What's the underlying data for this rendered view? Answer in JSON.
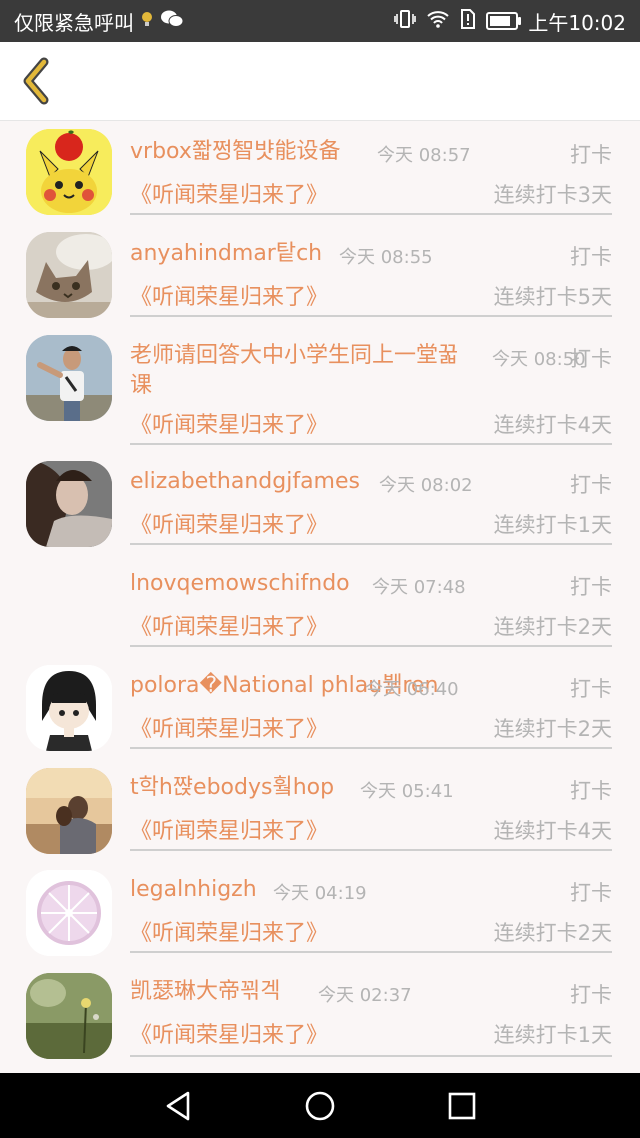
{
  "status_bar": {
    "left_text": "仅限紧急呼叫",
    "right_text": "上午10:02",
    "battery_level": 0.85,
    "icons": [
      "bulb-icon",
      "wechat-icon",
      "vibrate-icon",
      "wifi-icon",
      "sim-alert-icon",
      "battery-icon"
    ]
  },
  "header": {
    "back_icon": "chevron-left-icon",
    "accent_color": "#e2b83a"
  },
  "colors": {
    "name": "#e8905e",
    "muted": "#b4b4b4",
    "divider": "#cfcfcf"
  },
  "list": {
    "items": [
      {
        "name": "vrbox쫣쩡智뱟能设备",
        "time": "今天 08:57",
        "action": "打卡",
        "book": "《听闻荣星归来了》",
        "streak": "连续打卡3天",
        "avatar": "pikachu-avatar"
      },
      {
        "name": "anyahindmar탙ch",
        "time": "今天 08:55",
        "action": "打卡",
        "book": "《听闻荣星归来了》",
        "streak": "连续打卡5天",
        "avatar": "kitten-avatar"
      },
      {
        "name": "老师请回答大中小学生同上一堂꿃课",
        "time": "今天 08:50",
        "action": "打卡",
        "book": "《听闻荣星归来了》",
        "streak": "连续打卡4天",
        "avatar": "boy-avatar"
      },
      {
        "name": "elizabethandgjfames",
        "time": "今天 08:02",
        "action": "打卡",
        "book": "《听闻荣星归来了》",
        "streak": "连续打卡1天",
        "avatar": "woman-avatar"
      },
      {
        "name": "lnovqemowschifndo",
        "time": "今天 07:48",
        "action": "打卡",
        "book": "《听闻荣星归来了》",
        "streak": "连续打卡2天",
        "avatar": ""
      },
      {
        "name": "polora�National phlau뷁ren",
        "time": "今天 06:40",
        "action": "打卡",
        "book": "《听闻荣星归来了》",
        "streak": "连续打卡2天",
        "avatar": "cartoon-avatar"
      },
      {
        "name": "t학h쨙ebodys훸hop",
        "time": "今天 05:41",
        "action": "打卡",
        "book": "《听闻荣星归来了》",
        "streak": "连续打卡4天",
        "avatar": "couple-avatar"
      },
      {
        "name": "legalnhigzh",
        "time": "今天 04:19",
        "action": "打卡",
        "book": "《听闻荣星归来了》",
        "streak": "连续打卡2天",
        "avatar": "lemon-avatar"
      },
      {
        "name": "凯瑟琳大帝꾂겍",
        "time": "今天 02:37",
        "action": "打卡",
        "book": "《听闻荣星归来了》",
        "streak": "连续打卡1天",
        "avatar": "flower-avatar"
      }
    ]
  },
  "nav_bar": {
    "icons": [
      "back-triangle-icon",
      "home-circle-icon",
      "recents-square-icon"
    ]
  }
}
